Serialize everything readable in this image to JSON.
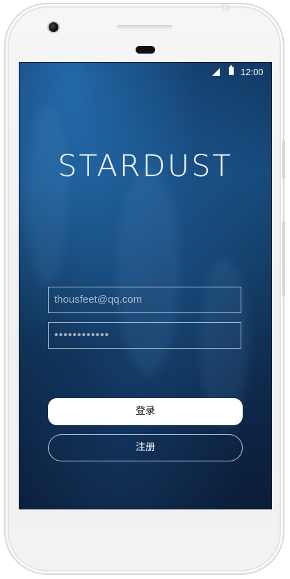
{
  "status_bar": {
    "time": "12:00",
    "signal_icon": "cellular-signal-icon",
    "battery_icon": "battery-icon"
  },
  "brand": {
    "title": "STARDUST"
  },
  "login_form": {
    "email_value": "thousfeet@qq.com",
    "password_value": "••••••••••••"
  },
  "actions": {
    "login_label": "登录",
    "register_label": "注册"
  },
  "colors": {
    "background_top": "#123a66",
    "background_bottom": "#0b1d38",
    "button_fill": "#ffffff",
    "text": "#ffffff"
  }
}
